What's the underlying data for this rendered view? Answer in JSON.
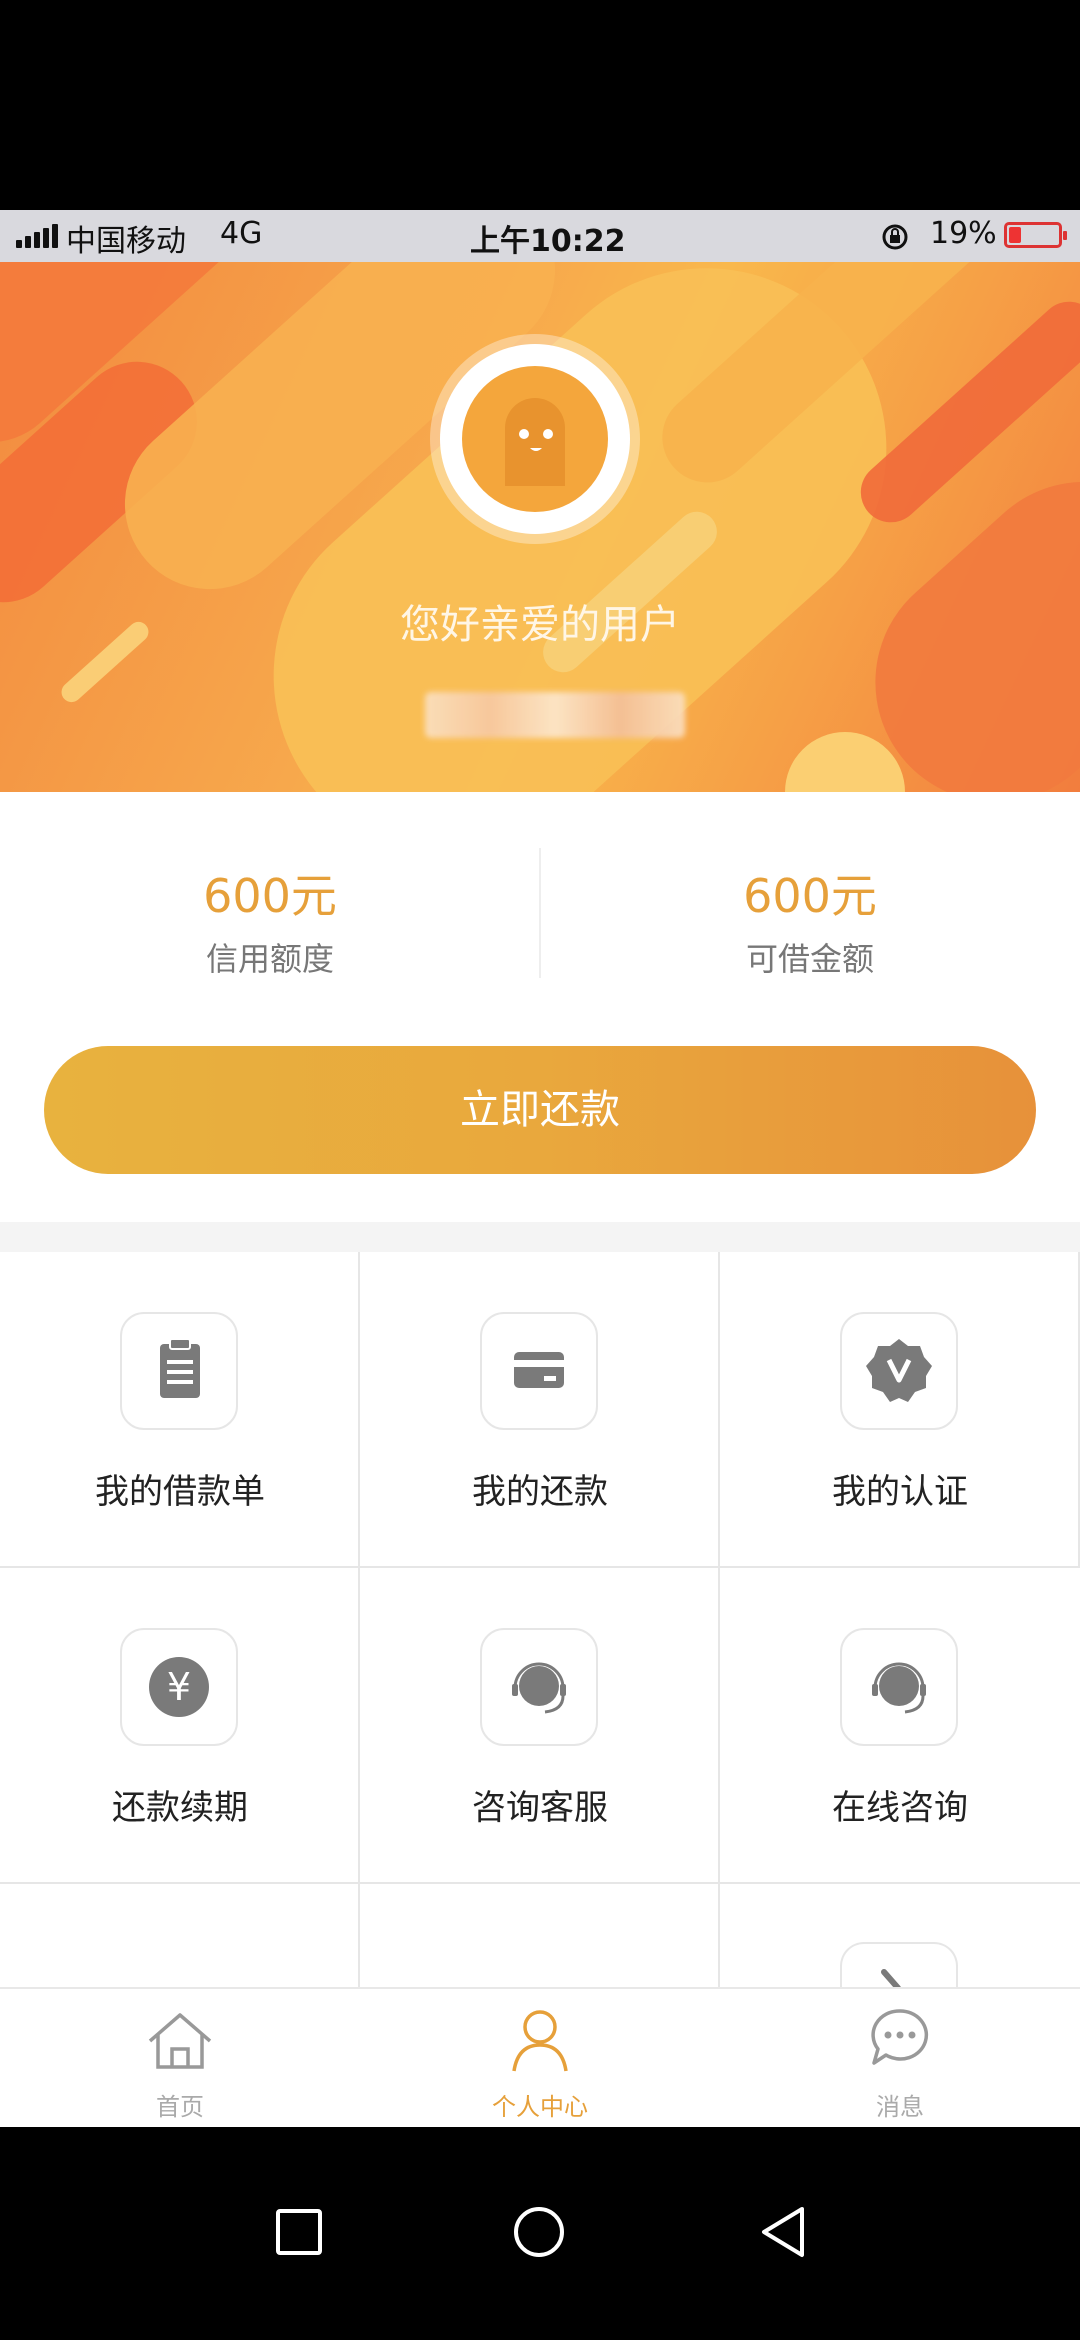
{
  "status_bar": {
    "carrier": "中国移动",
    "network": "4G",
    "time": "上午10:22",
    "battery": "19%"
  },
  "header": {
    "greeting": "您好亲爱的用户"
  },
  "stats": [
    {
      "value": "600元",
      "label": "信用额度"
    },
    {
      "value": "600元",
      "label": "可借金额"
    }
  ],
  "repay_button": "立即还款",
  "grid": [
    {
      "label": "我的借款单",
      "icon": "clipboard-icon"
    },
    {
      "label": "我的还款",
      "icon": "card-icon"
    },
    {
      "label": "我的认证",
      "icon": "verified-badge-icon"
    },
    {
      "label": "还款续期",
      "icon": "yen-icon"
    },
    {
      "label": "咨询客服",
      "icon": "headset-icon"
    },
    {
      "label": "在线咨询",
      "icon": "headset-icon"
    }
  ],
  "tabs": [
    {
      "label": "首页",
      "icon": "home-icon",
      "active": false
    },
    {
      "label": "个人中心",
      "icon": "user-icon",
      "active": true
    },
    {
      "label": "消息",
      "icon": "chat-icon",
      "active": false
    }
  ],
  "colors": {
    "accent": "#e6a03a",
    "header_orange": "#f7a84c"
  }
}
